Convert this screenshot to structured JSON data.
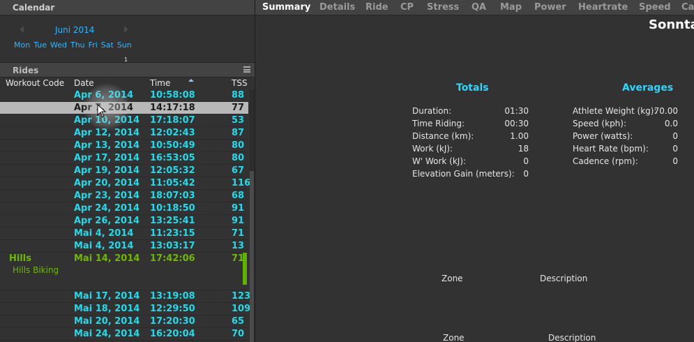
{
  "calendar": {
    "title": "Calendar",
    "month_label": "Juni 2014",
    "weekdays": [
      "Mon",
      "Tue",
      "Wed",
      "Thu",
      "Fri",
      "Sat",
      "Sun"
    ],
    "first_day_number": "1"
  },
  "rides": {
    "title": "Rides",
    "columns": {
      "workout_code": "Workout Code",
      "date": "Date",
      "time": "Time",
      "tss": "TSS"
    },
    "rows": [
      {
        "date": "Apr 6, 2014",
        "time": "10:58:08",
        "tss": "88"
      },
      {
        "date": "Apr 7, 2014",
        "time": "14:17:18",
        "tss": "77",
        "selected": true
      },
      {
        "date": "Apr 10, 2014",
        "time": "17:18:07",
        "tss": "53"
      },
      {
        "date": "Apr 12, 2014",
        "time": "12:02:43",
        "tss": "87"
      },
      {
        "date": "Apr 13, 2014",
        "time": "10:50:49",
        "tss": "80"
      },
      {
        "date": "Apr 17, 2014",
        "time": "16:53:05",
        "tss": "80"
      },
      {
        "date": "Apr 19, 2014",
        "time": "12:05:32",
        "tss": "67"
      },
      {
        "date": "Apr 20, 2014",
        "time": "11:05:42",
        "tss": "116"
      },
      {
        "date": "Apr 23, 2014",
        "time": "18:07:03",
        "tss": "68"
      },
      {
        "date": "Apr 24, 2014",
        "time": "10:18:50",
        "tss": "91"
      },
      {
        "date": "Apr 26, 2014",
        "time": "13:25:41",
        "tss": "91"
      },
      {
        "date": "Mai 4, 2014",
        "time": "11:23:15",
        "tss": "71"
      },
      {
        "date": "Mai 4, 2014",
        "time": "13:03:17",
        "tss": "13"
      },
      {
        "date": "Mai 14, 2014",
        "time": "17:42:06",
        "tss": "71",
        "workout_code": "Hills",
        "description": "Hills Biking"
      },
      {
        "date": "Mai 17, 2014",
        "time": "13:19:08",
        "tss": "123"
      },
      {
        "date": "Mai 18, 2014",
        "time": "12:29:50",
        "tss": "109"
      },
      {
        "date": "Mai 20, 2014",
        "time": "17:20:30",
        "tss": "65"
      },
      {
        "date": "Mai 24, 2014",
        "time": "16:20:04",
        "tss": "70"
      }
    ]
  },
  "tabs": [
    "Summary",
    "Details",
    "Ride",
    "CP",
    "Stress",
    "QA",
    "Map",
    "Power",
    "Heartrate",
    "Speed",
    "Ca"
  ],
  "active_tab": "Summary",
  "day_title": "Sonnta",
  "totals": {
    "title": "Totals",
    "items": [
      {
        "label": "Duration:",
        "value": "01:30"
      },
      {
        "label": "Time Riding:",
        "value": "00:30"
      },
      {
        "label": "Distance (km):",
        "value": "1.00"
      },
      {
        "label": "Work (kJ):",
        "value": "18"
      },
      {
        "label": "W' Work (kJ):",
        "value": "0"
      },
      {
        "label": "Elevation Gain (meters):",
        "value": "0"
      }
    ]
  },
  "averages": {
    "title": "Averages",
    "items": [
      {
        "label": "Athlete Weight (kg):",
        "value": "70.00"
      },
      {
        "label": "Speed (kph):",
        "value": "0.0"
      },
      {
        "label": "Power (watts):",
        "value": "0"
      },
      {
        "label": "Heart Rate (bpm):",
        "value": "0"
      },
      {
        "label": "Cadence (rpm):",
        "value": "0"
      }
    ]
  },
  "zones": [
    {
      "zone_label": "Zone",
      "description_label": "Description"
    },
    {
      "zone_label": "Zone",
      "description_label": "Description"
    }
  ]
}
